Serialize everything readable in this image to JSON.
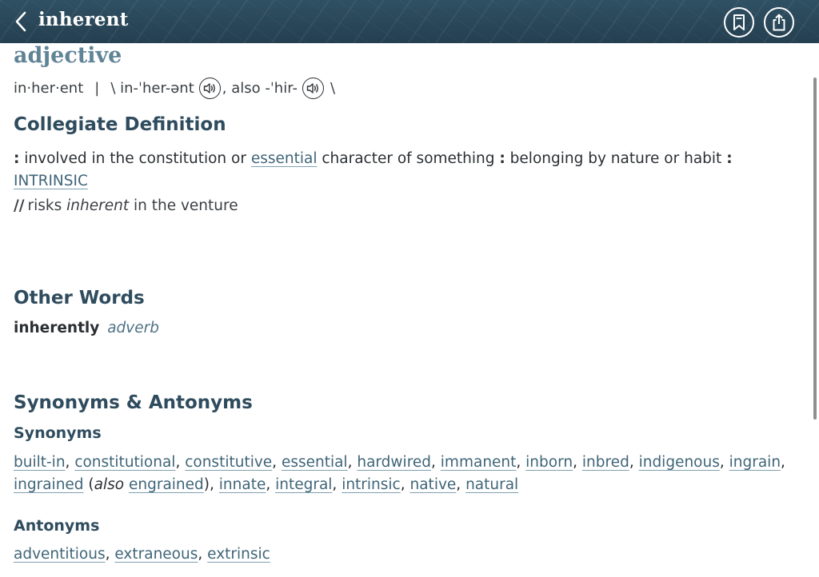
{
  "header": {
    "title": "inherent",
    "back_icon": "chevron-left-icon",
    "bookmark_icon": "bookmark-icon",
    "share_icon": "share-icon",
    "colors": {
      "bar": "#2a4859",
      "text": "#ffffff"
    }
  },
  "entry": {
    "part_of_speech": "adjective",
    "syllables": "in·her·ent",
    "separator": "|",
    "pron_open": "\\ in-ˈher-ənt",
    "pron_also": ", also -ˈhir-",
    "pron_close": "\\"
  },
  "collegiate": {
    "heading": "Collegiate Definition",
    "colon1": ":",
    "text1": " involved in the constitution or ",
    "link1": "essential",
    "text2": " character of something ",
    "colon2": ":",
    "text3": " belonging by nature or habit ",
    "colon3": ":",
    "link2": "INTRINSIC",
    "example_slashes": "//",
    "example_before": "risks ",
    "example_word": "inherent",
    "example_after": " in the venture"
  },
  "other_words": {
    "heading": "Other Words",
    "word": "inherently",
    "type": "adverb"
  },
  "syn_ant": {
    "heading": "Synonyms & Antonyms",
    "synonyms_heading": "Synonyms",
    "synonyms": [
      "built-in",
      "constitutional",
      "constitutive",
      "essential",
      "hardwired",
      "immanent",
      "inborn",
      "inbred",
      "indigenous",
      "ingrain",
      "ingrained"
    ],
    "also_label": "also",
    "also_word": "engrained",
    "synonyms_tail": [
      "innate",
      "integral",
      "intrinsic",
      "native",
      "natural"
    ],
    "antonyms_heading": "Antonyms",
    "antonyms": [
      "adventitious",
      "extraneous",
      "extrinsic"
    ]
  },
  "colors": {
    "heading": "#2f4c5e",
    "part_of_speech": "#5f8496",
    "link": "#3f6578"
  }
}
